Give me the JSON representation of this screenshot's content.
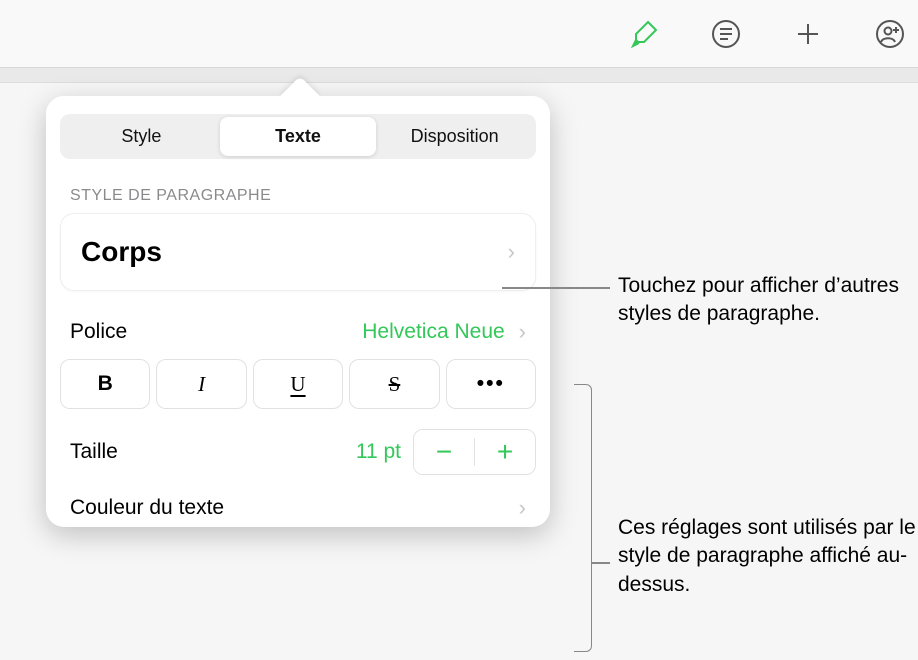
{
  "toolbar": {
    "format_icon": "paintbrush-icon",
    "toc_icon": "list-icon",
    "insert_icon": "plus-icon",
    "collab_icon": "person-add-icon"
  },
  "tabs": {
    "style": "Style",
    "text": "Texte",
    "layout": "Disposition"
  },
  "paragraph": {
    "section_label": "STYLE DE PARAGRAPHE",
    "current_style": "Corps"
  },
  "font": {
    "label": "Police",
    "value": "Helvetica Neue"
  },
  "format_buttons": {
    "bold": "B",
    "italic": "I",
    "underline": "U",
    "strike": "S",
    "more": "•••"
  },
  "size": {
    "label": "Taille",
    "value": "11 pt",
    "minus": "−",
    "plus": "+"
  },
  "textcolor": {
    "label": "Couleur du texte",
    "value": "#000000"
  },
  "callouts": {
    "styles": "Touchez pour afficher d’autres styles de paragraphe.",
    "settings": "Ces réglages sont utilisés par le style de paragraphe affiché au-dessus."
  }
}
